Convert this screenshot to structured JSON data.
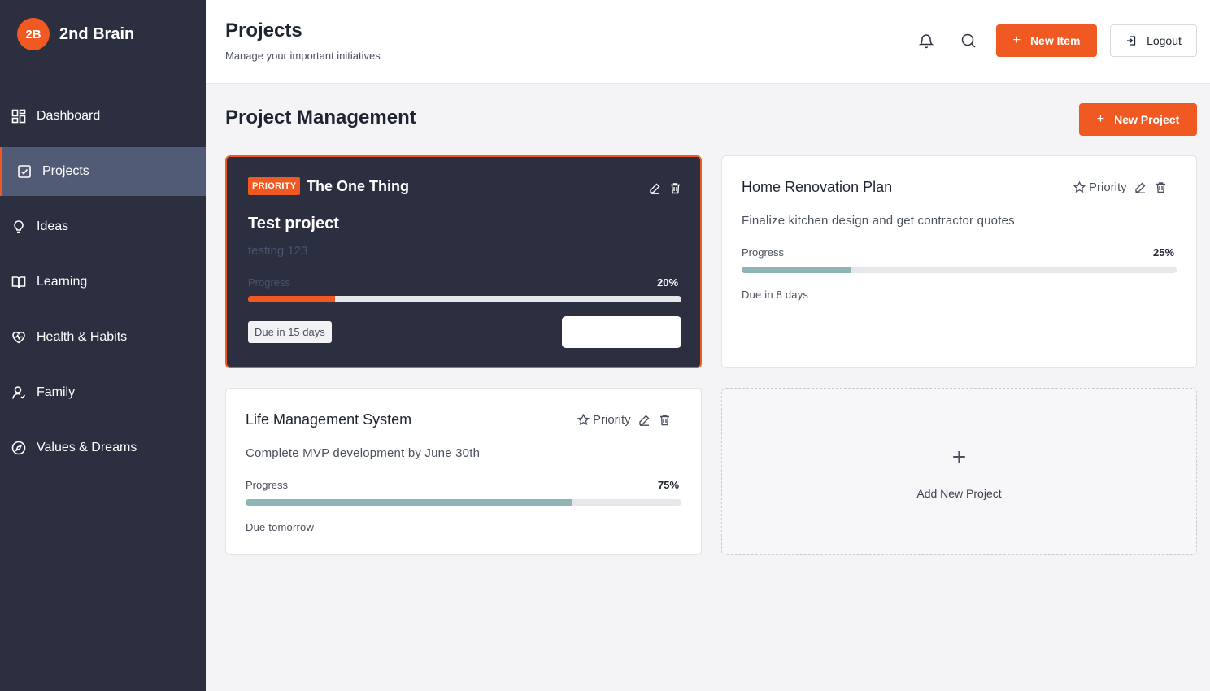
{
  "brand": {
    "logo": "2B",
    "name": "2nd Brain"
  },
  "sidebar": {
    "items": [
      {
        "label": "Dashboard",
        "icon": "dashboard-icon"
      },
      {
        "label": "Projects",
        "icon": "checkbox-icon",
        "active": true
      },
      {
        "label": "Ideas",
        "icon": "lightbulb-icon"
      },
      {
        "label": "Learning",
        "icon": "book-icon"
      },
      {
        "label": "Health & Habits",
        "icon": "heart-pulse-icon"
      },
      {
        "label": "Family",
        "icon": "user-icon"
      },
      {
        "label": "Values & Dreams",
        "icon": "compass-icon"
      }
    ]
  },
  "header": {
    "title": "Projects",
    "subtitle": "Manage your important initiatives",
    "new_item": "New Item",
    "logout": "Logout"
  },
  "main": {
    "section_title": "Project Management",
    "new_project": "New Project",
    "add_new_project": "Add New Project",
    "plus": "+",
    "progress_label": "Progress",
    "priority_label": "Priority"
  },
  "cards": [
    {
      "badge": "PRIORITY",
      "title": "The One Thing",
      "subtitle": "Test project",
      "description": "testing 123",
      "progress_text": "20%",
      "progress": 0.2,
      "due": "Due in 15 days"
    },
    {
      "title": "Home Renovation Plan",
      "description": "Finalize kitchen design and get contractor quotes",
      "progress_text": "25%",
      "progress": 0.25,
      "due": "Due in 8 days"
    },
    {
      "title": "Life Management System",
      "description": "Complete MVP development by June 30th",
      "progress_text": "75%",
      "progress": 0.75,
      "due": "Due tomorrow"
    }
  ],
  "colors": {
    "accent": "#f05a22",
    "sidebar": "#2c2f40",
    "progress": "#8fb4b5"
  }
}
